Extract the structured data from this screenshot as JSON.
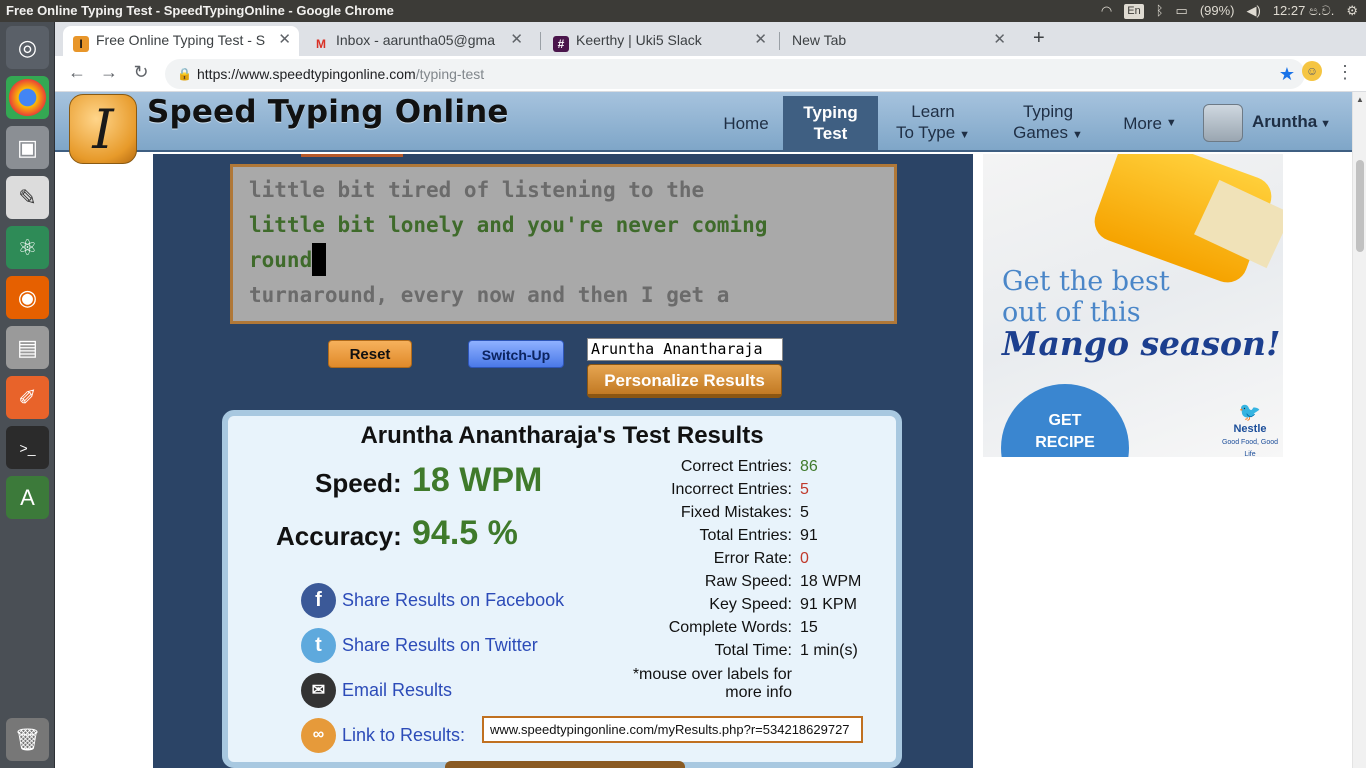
{
  "os": {
    "window_title": "Free Online Typing Test - SpeedTypingOnline - Google Chrome",
    "battery": "(99%)",
    "clock": "12:27 ප.ව.",
    "lang": "En"
  },
  "browser": {
    "tabs": [
      {
        "title": "Free Online Typing Test - S",
        "fav": "I",
        "fav_color": "#e8962a"
      },
      {
        "title": "Inbox - aaruntha05@gma",
        "fav": "M",
        "fav_color": "#d93025"
      },
      {
        "title": "Keerthy | Uki5 Slack",
        "fav": "#",
        "fav_color": "#4a154b"
      },
      {
        "title": "New Tab",
        "fav": "",
        "fav_color": ""
      }
    ],
    "url_host": "https://www.speedtypingonline.com",
    "url_path": "/typing-test"
  },
  "site": {
    "name": "Speed Typing Online",
    "logo_letter": "I",
    "nav": {
      "home": "Home",
      "typing_test_1": "Typing",
      "typing_test_2": "Test",
      "learn_1": "Learn",
      "learn_2": "To Type",
      "games_1": "Typing",
      "games_2": "Games",
      "more": "More"
    },
    "user": "Aruntha"
  },
  "typing": {
    "line1": "little bit tired of listening to the",
    "line2": "little bit lonely and you're never coming",
    "line3": "round",
    "line4": "turnaround, every now and then I get a"
  },
  "controls": {
    "reset": "Reset",
    "switch_up": "Switch-Up",
    "name_value": "Aruntha Anantharaja",
    "personalize": "Personalize Results"
  },
  "results": {
    "title": "Aruntha Anantharaja's Test Results",
    "speed_label": "Speed:",
    "speed_value": "18 WPM",
    "accuracy_label": "Accuracy:",
    "accuracy_value": "94.5 %",
    "stats": [
      {
        "label": "Correct Entries:",
        "value": "86",
        "color": "#3f7a2b"
      },
      {
        "label": "Incorrect Entries:",
        "value": "5",
        "color": "#c0392b"
      },
      {
        "label": "Fixed Mistakes:",
        "value": "5",
        "color": "#111111"
      },
      {
        "label": "Total Entries:",
        "value": "91",
        "color": "#111111"
      },
      {
        "label": "Error Rate:",
        "value": "0",
        "color": "#c0392b"
      },
      {
        "label": "Raw Speed:",
        "value": "18 WPM",
        "color": "#111111"
      },
      {
        "label": "Key Speed:",
        "value": "91 KPM",
        "color": "#111111"
      },
      {
        "label": "Complete Words:",
        "value": "15",
        "color": "#111111"
      },
      {
        "label": "Total Time:",
        "value": "1 min(s)",
        "color": "#111111"
      }
    ],
    "note_1": "*mouse over labels for",
    "note_2": "more info",
    "share_facebook": "Share Results on Facebook",
    "share_twitter": "Share Results on Twitter",
    "email": "Email Results",
    "link_label": "Link to Results:",
    "link_value": "www.speedtypingonline.com/myResults.php?r=534218629727"
  },
  "ad": {
    "line_a": "Get the best",
    "line_b": "out of this",
    "line_c": "Mango season!",
    "recipe_1": "GET",
    "recipe_2": "RECIPE",
    "brand": "Nestle",
    "tagline": "Good Food, Good Life"
  }
}
